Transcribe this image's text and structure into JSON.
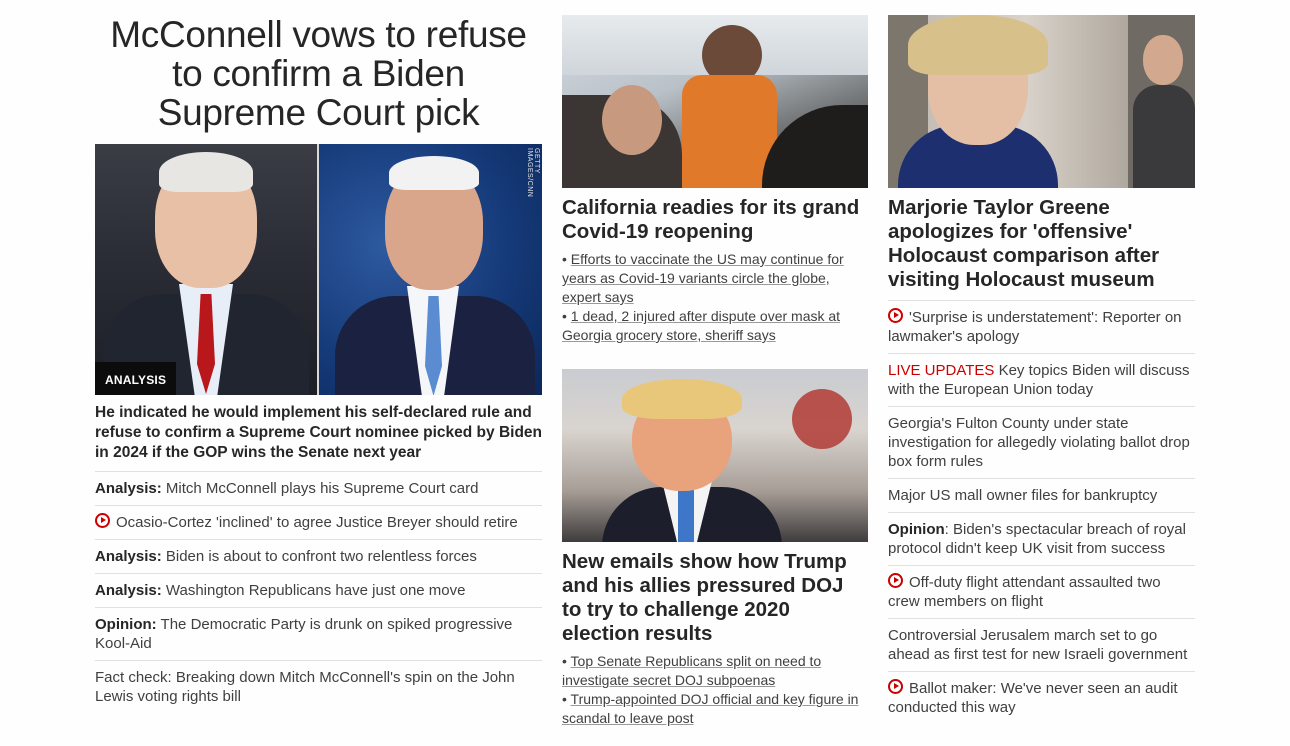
{
  "lead": {
    "headline_lines": [
      "McConnell vows to refuse",
      "to confirm a Biden",
      "Supreme Court pick"
    ],
    "image_credit": "GETTY IMAGES/CNN",
    "badge": "ANALYSIS",
    "dek": "He indicated he would implement his self-declared rule and refuse to confirm a Supreme Court nominee picked by Biden in 2024 if the GOP wins the Senate next year",
    "related": [
      {
        "prefix": "Analysis:",
        "text": " Mitch McConnell plays his Supreme Court card",
        "video": false
      },
      {
        "prefix": "",
        "text": "Ocasio-Cortez 'inclined' to agree Justice Breyer should retire",
        "video": true
      },
      {
        "prefix": "Analysis:",
        "text": " Biden is about to confront two relentless forces",
        "video": false
      },
      {
        "prefix": "Analysis:",
        "text": " Washington Republicans have just one move",
        "video": false
      },
      {
        "prefix": "Opinion:",
        "text": " The Democratic Party is drunk on spiked progressive Kool-Aid",
        "video": false
      },
      {
        "prefix": "",
        "text": "Fact check: Breaking down Mitch McConnell's spin on the John Lewis voting rights bill",
        "video": false
      }
    ]
  },
  "middle": {
    "story1": {
      "headline": "California readies for its grand Covid-19 reopening",
      "bullets": [
        "Efforts to vaccinate the US may continue for years as Covid-19 variants circle the globe, expert says",
        "1 dead, 2 injured after dispute over mask at Georgia grocery store, sheriff says"
      ]
    },
    "story2": {
      "headline": "New emails show how Trump and his allies pressured DOJ to try to challenge 2020 election results",
      "bullets": [
        "Top Senate Republicans split on need to investigate secret DOJ subpoenas",
        "Trump-appointed DOJ official and key figure in scandal to leave post"
      ]
    }
  },
  "right": {
    "headline": "Marjorie Taylor Greene apologizes for 'offensive' Holocaust comparison after visiting Holocaust museum",
    "items": [
      {
        "video": true,
        "live": "",
        "prefix": "",
        "text": "'Surprise is understatement': Reporter on lawmaker's apology"
      },
      {
        "video": false,
        "live": "LIVE UPDATES",
        "prefix": "",
        "text": " Key topics Biden will discuss with the European Union today"
      },
      {
        "video": false,
        "live": "",
        "prefix": "",
        "text": "Georgia's Fulton County under state investigation for allegedly violating ballot drop box form rules"
      },
      {
        "video": false,
        "live": "",
        "prefix": "",
        "text": "Major US mall owner files for bankruptcy"
      },
      {
        "video": false,
        "live": "",
        "prefix": "Opinion",
        "text": ": Biden's spectacular breach of royal protocol didn't keep UK visit from success"
      },
      {
        "video": true,
        "live": "",
        "prefix": "",
        "text": "Off-duty flight attendant assaulted two crew members on flight"
      },
      {
        "video": false,
        "live": "",
        "prefix": "",
        "text": "Controversial Jerusalem march set to go ahead as first test for new Israeli government"
      },
      {
        "video": true,
        "live": "",
        "prefix": "",
        "text": "Ballot maker: We've never seen an audit conducted this way"
      }
    ]
  },
  "colors": {
    "accent_red": "#cc0000",
    "text": "#262626",
    "badge_bg": "#0c0c0c"
  }
}
